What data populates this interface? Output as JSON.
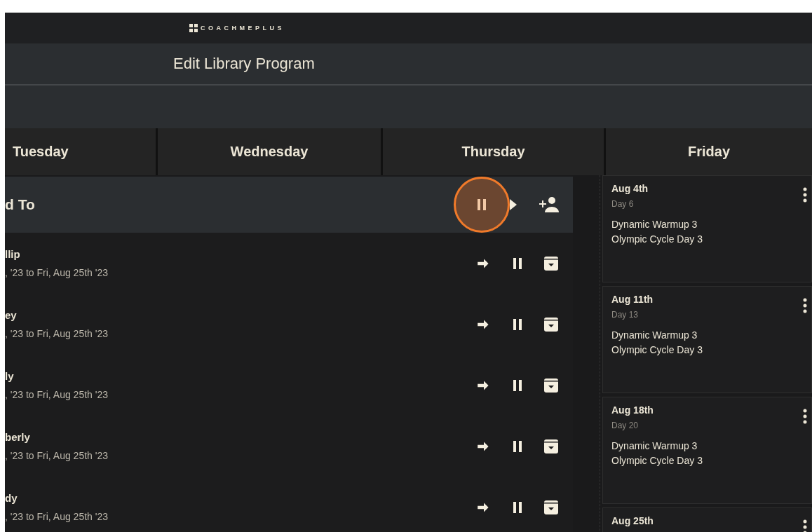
{
  "header": {
    "logo": "COACHMEPLUS"
  },
  "page_title": "Edit Library Program",
  "days": [
    {
      "label": "Tuesday"
    },
    {
      "label": "Wednesday"
    },
    {
      "label": "Thursday"
    },
    {
      "label": "Friday"
    }
  ],
  "assigned_panel": {
    "title": "d To",
    "pause_pressed": true,
    "athletes": [
      {
        "name": "llip",
        "dates": ", '23 to Fri, Aug 25th '23"
      },
      {
        "name": "ey",
        "dates": ", '23 to Fri, Aug 25th '23"
      },
      {
        "name": "ly",
        "dates": ", '23 to Fri, Aug 25th '23"
      },
      {
        "name": "berly",
        "dates": ", '23 to Fri, Aug 25th '23"
      },
      {
        "name": "dy",
        "dates": ", '23 to Fri, Aug 25th '23"
      }
    ]
  },
  "friday_cards": [
    {
      "date": "Aug 4th",
      "day": "Day 6",
      "workouts": [
        "Dynamic Warmup 3",
        "Olympic Cycle Day 3"
      ]
    },
    {
      "date": "Aug 11th",
      "day": "Day 13",
      "workouts": [
        "Dynamic Warmup 3",
        "Olympic Cycle Day 3"
      ]
    },
    {
      "date": "Aug 18th",
      "day": "Day 20",
      "workouts": [
        "Dynamic Warmup 3",
        "Olympic Cycle Day 3"
      ]
    },
    {
      "date": "Aug 25th"
    }
  ]
}
